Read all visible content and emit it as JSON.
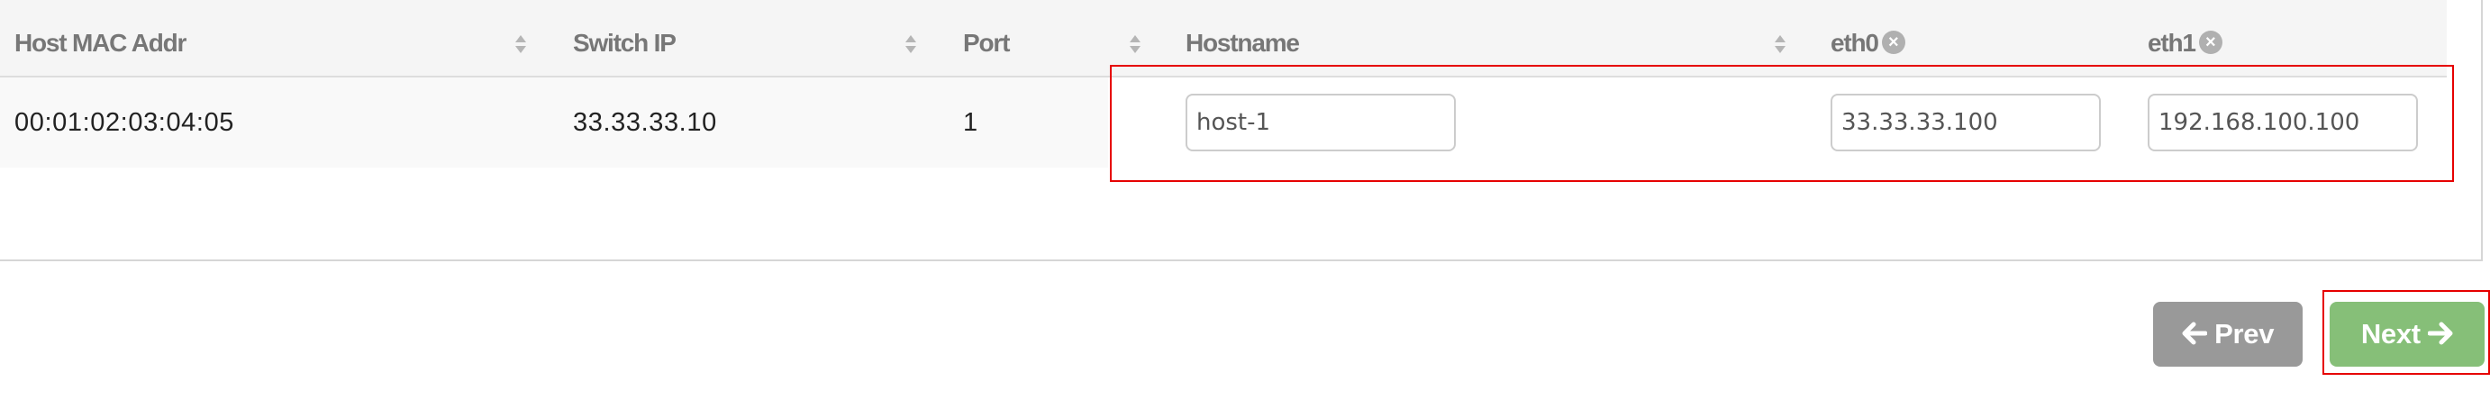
{
  "table": {
    "columns": [
      {
        "label": "Host MAC Addr",
        "sortable": true
      },
      {
        "label": "Switch IP",
        "sortable": true
      },
      {
        "label": "Port",
        "sortable": true
      },
      {
        "label": "Hostname",
        "sortable": true
      },
      {
        "label": "eth0",
        "removable": true
      },
      {
        "label": "eth1",
        "removable": true
      }
    ],
    "rows": [
      {
        "mac": "00:01:02:03:04:05",
        "switch_ip": "33.33.33.10",
        "port": "1",
        "hostname": "host-1",
        "eth0": "33.33.33.100",
        "eth1": "192.168.100.100"
      }
    ]
  },
  "icons": {
    "sort": "sort-icon",
    "remove": "remove-column-icon",
    "prev_arrow": "arrow-left-icon",
    "next_arrow": "arrow-right-icon"
  },
  "buttons": {
    "prev_label": "Prev",
    "next_label": "Next"
  },
  "colors": {
    "highlight": "#e60000",
    "prev_button": "#999999",
    "next_button": "#86bf78",
    "header_bg": "#f5f5f5"
  }
}
